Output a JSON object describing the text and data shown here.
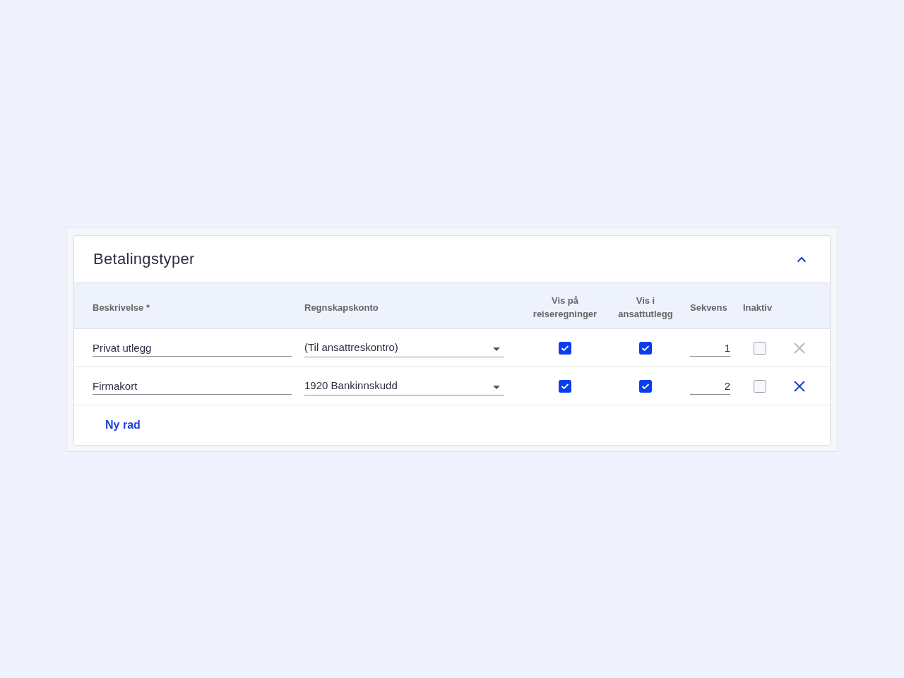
{
  "panel": {
    "title": "Betalingstyper",
    "expanded": true
  },
  "table": {
    "columns": [
      "Beskrivelse *",
      "Regnskapskonto",
      "Vis på reiseregninger",
      "Vis i ansattutlegg",
      "Sekvens",
      "Inaktiv"
    ],
    "rows": [
      {
        "description": "Privat utlegg",
        "account": "(Til ansattreskontro)",
        "show_on_travel": true,
        "show_on_expenses": true,
        "sequence": "1",
        "inactive": false,
        "delete_disabled": true
      },
      {
        "description": "Firmakort",
        "account": "1920 Bankinnskudd",
        "show_on_travel": true,
        "show_on_expenses": true,
        "sequence": "2",
        "inactive": false,
        "delete_disabled": false
      }
    ]
  },
  "add_row_button": "Ny rad"
}
